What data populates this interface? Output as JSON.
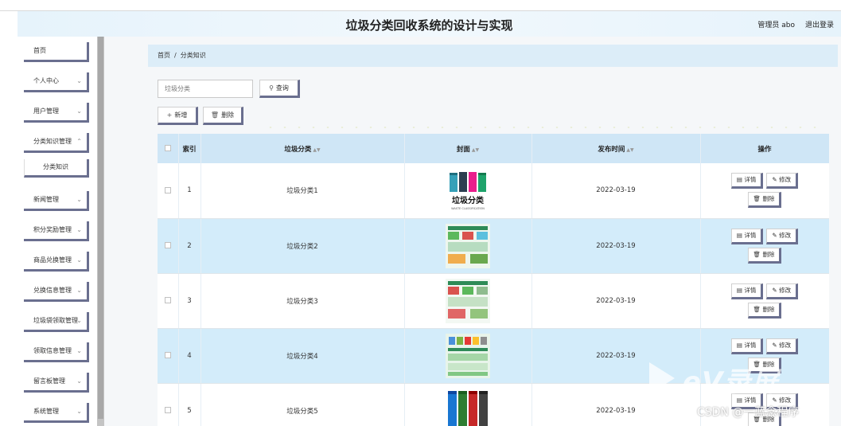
{
  "app": {
    "title": "垃圾分类回收系统的设计与实现",
    "user_label": "管理员 abo",
    "logout_label": "退出登录"
  },
  "sidebar": {
    "items": [
      {
        "label": "首页",
        "expandable": false
      },
      {
        "label": "个人中心",
        "expandable": true
      },
      {
        "label": "用户管理",
        "expandable": true
      },
      {
        "label": "分类知识管理",
        "expandable": true
      },
      {
        "label": "新闻管理",
        "expandable": true
      },
      {
        "label": "积分奖励管理",
        "expandable": true
      },
      {
        "label": "商品兑换管理",
        "expandable": true
      },
      {
        "label": "兑换信息管理",
        "expandable": true
      },
      {
        "label": "垃圾袋领取管理",
        "expandable": true
      },
      {
        "label": "领取信息管理",
        "expandable": true
      },
      {
        "label": "留言板管理",
        "expandable": true
      },
      {
        "label": "系统管理",
        "expandable": true
      }
    ],
    "submenu": {
      "label": "分类知识"
    }
  },
  "breadcrumb": {
    "home": "首页",
    "sep": "/",
    "current": "分类知识"
  },
  "search": {
    "placeholder": "垃圾分类",
    "button_label": "查询"
  },
  "toolbar": {
    "add_label": "新增",
    "delete_label": "删除"
  },
  "table": {
    "columns": {
      "index": "索引",
      "category": "垃圾分类",
      "cover": "封面",
      "publish_time": "发布时间",
      "actions": "操作"
    },
    "rows": [
      {
        "index": "1",
        "category": "垃圾分类1",
        "cover_text": "垃圾分类",
        "cover_subtext": "WASTE CLASSIFICATION",
        "publish_time": "2022-03-19"
      },
      {
        "index": "2",
        "category": "垃圾分类2",
        "publish_time": "2022-03-19"
      },
      {
        "index": "3",
        "category": "垃圾分类3",
        "publish_time": "2022-03-19"
      },
      {
        "index": "4",
        "category": "垃圾分类4",
        "publish_time": "2022-03-19"
      },
      {
        "index": "5",
        "category": "垃圾分类5",
        "publish_time": "2022-03-19"
      }
    ],
    "action_labels": {
      "detail": "详情",
      "edit": "修改",
      "delete": "删除"
    }
  },
  "overlay": {
    "watermark": "CSDN @一蓝念程序",
    "logo_text": "eV录屏"
  },
  "colors": {
    "header_bg": "#e6f3fb",
    "table_header_bg": "#cfe6f6",
    "row_alt_bg": "#d3ecfa",
    "button_shadow": "#6a6f8f",
    "scrollbar": "#a8a8a8"
  }
}
